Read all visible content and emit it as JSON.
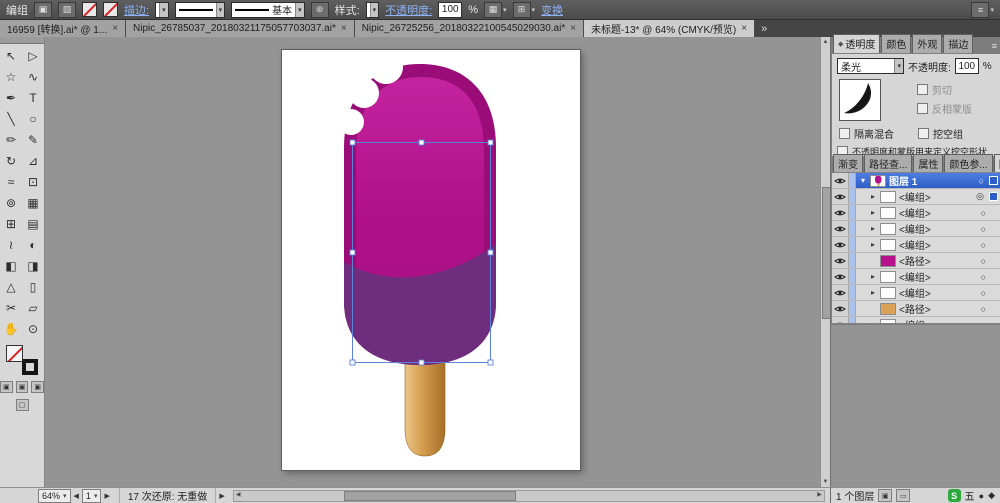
{
  "topbar": {
    "group_label": "编组",
    "stroke_link": "描边:",
    "brush_value": "基本",
    "style_label": "样式:",
    "opacity_label": "不透明度:",
    "opacity_value": "100",
    "percent": "%",
    "transform_link": "变换"
  },
  "doc_tabs": [
    {
      "label": "16959 [转换].ai* @ 1...",
      "active": false
    },
    {
      "label": "Nipic_26785037_20180321175057703037.ai*",
      "active": false
    },
    {
      "label": "Nipic_26725256_20180322100545029030.ai*",
      "active": false
    },
    {
      "label": "未标题-13* @ 64% (CMYK/预览)",
      "active": true
    }
  ],
  "tools": [
    {
      "name": "selection-tool",
      "glyph": "↖"
    },
    {
      "name": "direct-selection-tool",
      "glyph": "▷"
    },
    {
      "name": "magic-wand-tool",
      "glyph": "☆"
    },
    {
      "name": "lasso-tool",
      "glyph": "∿"
    },
    {
      "name": "pen-tool",
      "glyph": "✒"
    },
    {
      "name": "type-tool",
      "glyph": "T"
    },
    {
      "name": "line-segment-tool",
      "glyph": "╲"
    },
    {
      "name": "ellipse-tool",
      "glyph": "○"
    },
    {
      "name": "paintbrush-tool",
      "glyph": "✏"
    },
    {
      "name": "pencil-tool",
      "glyph": "✎"
    },
    {
      "name": "rotate-tool",
      "glyph": "↻"
    },
    {
      "name": "scale-tool",
      "glyph": "⊿"
    },
    {
      "name": "width-tool",
      "glyph": "≈"
    },
    {
      "name": "free-transform-tool",
      "glyph": "⊡"
    },
    {
      "name": "symbol-sprayer-tool",
      "glyph": "⊚"
    },
    {
      "name": "column-graph-tool",
      "glyph": "▦"
    },
    {
      "name": "mesh-tool",
      "glyph": "⊞"
    },
    {
      "name": "gradient-tool",
      "glyph": "▤"
    },
    {
      "name": "eyedropper-tool",
      "glyph": "≀"
    },
    {
      "name": "blend-tool",
      "glyph": "◐"
    },
    {
      "name": "live-paint-bucket-tool",
      "glyph": "◧"
    },
    {
      "name": "live-paint-selection-tool",
      "glyph": "◨"
    },
    {
      "name": "perspective-grid-tool",
      "glyph": "△"
    },
    {
      "name": "artboard-tool",
      "glyph": "▯"
    },
    {
      "name": "slice-tool",
      "glyph": "✂"
    },
    {
      "name": "eraser-tool",
      "glyph": "▱"
    },
    {
      "name": "hand-tool",
      "glyph": "✋"
    },
    {
      "name": "zoom-tool",
      "glyph": "⊙"
    }
  ],
  "transparency": {
    "tab_transparency": "透明度",
    "tab_color": "颜色",
    "tab_appearance": "外观",
    "tab_stroke": "描边",
    "blend_mode": "柔光",
    "opacity_label": "不透明度:",
    "opacity_value": "100",
    "percent": "%",
    "cb_clip": "剪切",
    "cb_invert_mask": "反相蒙版",
    "cb_isolate": "隔离混合",
    "cb_knockout": "挖空组",
    "cb_define": "不透明度和蒙版用来定义挖空形状"
  },
  "panel_tabs": {
    "gradient": "渐变",
    "pathfinder": "路径查...",
    "attributes": "属性",
    "color_guide": "颜色参...",
    "layers": "图层"
  },
  "layers": {
    "rows": [
      {
        "label": "图层 1",
        "kind": "layer",
        "thumb": "popsicle",
        "arrow": "▾",
        "target": "circle",
        "selected": true,
        "badge": true
      },
      {
        "label": "<编组>",
        "kind": "group",
        "thumb": "white",
        "arrow": "▸",
        "target": "double",
        "selected": false,
        "badge": true
      },
      {
        "label": "<编组>",
        "kind": "group",
        "thumb": "white",
        "arrow": "▸",
        "target": "circle",
        "selected": false,
        "badge": false
      },
      {
        "label": "<编组>",
        "kind": "group",
        "thumb": "white",
        "arrow": "▸",
        "target": "circle",
        "selected": false,
        "badge": false
      },
      {
        "label": "<编组>",
        "kind": "group",
        "thumb": "white",
        "arrow": "▸",
        "target": "circle",
        "selected": false,
        "badge": false
      },
      {
        "label": "<路径>",
        "kind": "path",
        "thumb": "#b5128c",
        "arrow": "",
        "target": "circle",
        "selected": false,
        "badge": false
      },
      {
        "label": "<编组>",
        "kind": "group",
        "thumb": "white",
        "arrow": "▸",
        "target": "circle",
        "selected": false,
        "badge": false
      },
      {
        "label": "<编组>",
        "kind": "group",
        "thumb": "white",
        "arrow": "▸",
        "target": "circle",
        "selected": false,
        "badge": false
      },
      {
        "label": "<路径>",
        "kind": "path",
        "thumb": "#d9a257",
        "arrow": "",
        "target": "circle",
        "selected": false,
        "badge": false
      },
      {
        "label": "<编组>",
        "kind": "group",
        "thumb": "white",
        "arrow": "▸",
        "target": "circle",
        "selected": false,
        "badge": false
      }
    ],
    "footer": "1 个图层"
  },
  "statusbar": {
    "zoom": "64%",
    "page": "1",
    "undo": "17 次还原: 无重做"
  },
  "tray": {
    "sogou": "S",
    "ime": "五"
  },
  "ui": {
    "close": "×",
    "chevron": "▾",
    "overflow": "»",
    "menu": "≡",
    "arrow_left": "◀",
    "arrow_right": "▶",
    "arrow_up": "▲",
    "arrow_down": "▼",
    "isolate_icon": "▣",
    "edit_icon": "▨",
    "recolor_icon": "⊛",
    "align_icon": "▦",
    "grid_icon": "⊞",
    "workspace_icon": "≡",
    "new_layer_icon": "▣",
    "delete_layer_icon": "▭",
    "tray_dot": "●",
    "tray_diamond": "◆",
    "diamond": "◆"
  },
  "colors": {
    "selection_blue": "#5b82d8",
    "layer_highlight_blue": "#2f5ec6",
    "popsicle_magenta": "#b0118a",
    "popsicle_dark_purple": "#6e2e7d",
    "popsicle_rim": "#9a0d79",
    "stick_tan": "#d49b4e",
    "sogou_green": "#2ca83c"
  }
}
